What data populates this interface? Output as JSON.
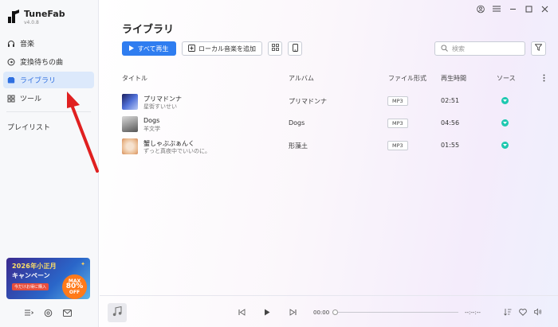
{
  "app": {
    "name": "TuneFab",
    "version": "v4.0.8"
  },
  "sidebar": {
    "items": [
      {
        "label": "音楽",
        "icon": "headphones-icon"
      },
      {
        "label": "変換待ちの曲",
        "icon": "convert-icon"
      },
      {
        "label": "ライブラリ",
        "icon": "library-icon",
        "active": true
      },
      {
        "label": "ツール",
        "icon": "tools-icon"
      }
    ],
    "playlist_label": "プレイリスト",
    "banner": {
      "line1": "2026年小正月",
      "line2": "キャンペーン",
      "cta": "今だけお得に購入",
      "badge_top": "MAX",
      "badge_mid": "80%",
      "badge_bot": "OFF"
    }
  },
  "main": {
    "title": "ライブラリ",
    "play_all_label": "すべて再生",
    "add_local_label": "ローカル音楽を追加",
    "search_placeholder": "検索",
    "columns": {
      "title": "タイトル",
      "album": "アルバム",
      "format": "ファイル形式",
      "duration": "再生時間",
      "source": "ソース"
    },
    "rows": [
      {
        "title": "プリマドンナ",
        "artist": "星街すいせい",
        "album": "プリマドンナ",
        "format": "MP3",
        "duration": "02:51"
      },
      {
        "title": "Dogs",
        "artist": "羊文学",
        "album": "Dogs",
        "format": "MP3",
        "duration": "04:56"
      },
      {
        "title": "蟹しゃぶぶぁんく",
        "artist": "ずっと真夜中でいいのに。",
        "album": "形藻土",
        "format": "MP3",
        "duration": "01:55"
      }
    ]
  },
  "player": {
    "current_time": "00:00",
    "total_time": "--:--:--",
    "progress": 0
  },
  "colors": {
    "accent": "#2f7df0",
    "active_bg": "#dce9fb",
    "source": "#1fc8b0",
    "arrow": "#e02020"
  }
}
